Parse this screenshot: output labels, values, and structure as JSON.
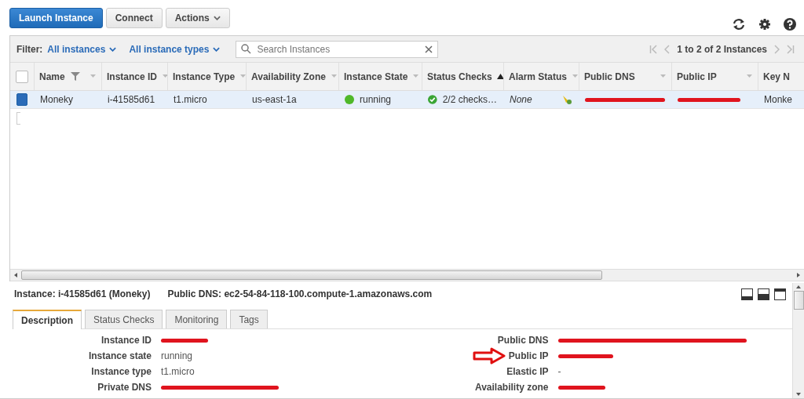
{
  "toolbar": {
    "buttons": [
      {
        "label": "Launch Instance",
        "kind": "primary"
      },
      {
        "label": "Connect",
        "kind": "plain"
      },
      {
        "label": "Actions",
        "kind": "menu"
      }
    ]
  },
  "filter": {
    "label": "Filter:",
    "dropdowns": [
      "All instances",
      "All instance types"
    ],
    "search": {
      "placeholder": "Search Instances"
    },
    "pagination": "1 to 2 of 2 Instances"
  },
  "table": {
    "all_selected": false,
    "columns": [
      {
        "label": "Name",
        "sorted_asc": false,
        "filter": true
      },
      {
        "label": "Instance ID",
        "sorted_asc": false
      },
      {
        "label": "Instance Type",
        "sorted_asc": false
      },
      {
        "label": "Availability Zone",
        "sorted_asc": false
      },
      {
        "label": "Instance State",
        "sorted_asc": false
      },
      {
        "label": "Status Checks",
        "sorted_asc": true
      },
      {
        "label": "Alarm Status",
        "sorted_asc": false
      },
      {
        "label": "Public DNS",
        "sorted_asc": false
      },
      {
        "label": "Public IP",
        "sorted_asc": false
      },
      {
        "label": "Key N"
      }
    ],
    "rows": [
      {
        "selected": true,
        "name": "Moneky",
        "instance_id": "i-41585d61",
        "instance_type": "t1.micro",
        "zone": "us-east-1a",
        "state": "running",
        "status_checks": "2/2 checks…",
        "alarm": "None",
        "key": "Monke"
      }
    ]
  },
  "details": {
    "title": "Instance: i-41585d61 (Moneky)",
    "public_dns": "Public DNS: ec2-54-84-118-100.compute-1.amazonaws.com",
    "tabs": [
      {
        "label": "Description",
        "selected": true
      },
      {
        "label": "Status Checks",
        "selected": false
      },
      {
        "label": "Monitoring",
        "selected": false
      },
      {
        "label": "Tags",
        "selected": false
      }
    ],
    "left": [
      {
        "label": "Instance ID",
        "redacted": true
      },
      {
        "label": "Instance state",
        "value": "running",
        "redacted": false
      },
      {
        "label": "Instance type",
        "value": "t1.micro",
        "redacted": false
      },
      {
        "label": "Private DNS",
        "redacted": true
      }
    ],
    "right": [
      {
        "label": "Public DNS",
        "redacted": true,
        "pointed": false
      },
      {
        "label": "Public IP",
        "redacted": true,
        "pointed": true
      },
      {
        "label": "Elastic IP",
        "value": "-",
        "redacted": false,
        "pointed": false
      },
      {
        "label": "Availability zone",
        "redacted": true,
        "pointed": false
      }
    ]
  }
}
